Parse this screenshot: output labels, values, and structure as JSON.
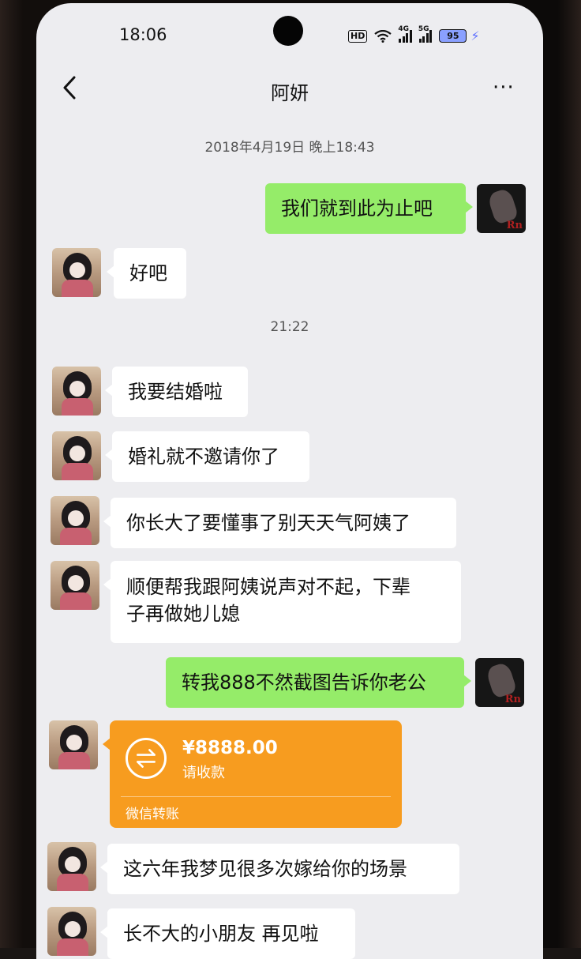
{
  "status_bar": {
    "time": "18:06",
    "hd": "HD",
    "signal1": "4G",
    "signal2": "5G",
    "battery": "95"
  },
  "header": {
    "title": "阿妍",
    "more": "···"
  },
  "timestamps": {
    "first": "2018年4月19日 晚上18:43",
    "second": "21:22"
  },
  "messages": {
    "m1": "我们就到此为止吧",
    "m2": "好吧",
    "m3": "我要结婚啦",
    "m4": "婚礼就不邀请你了",
    "m5": "你长大了要懂事了别天天气阿姨了",
    "m6_line1": "顺便帮我跟阿姨说声对不起，下辈",
    "m6_line2": "子再做她儿媳",
    "m7": "转我888不然截图告诉你老公",
    "m9": "这六年我梦见很多次嫁给你的场景",
    "m10": "长不大的小朋友 再见啦"
  },
  "transfer": {
    "amount": "¥8888.00",
    "status": "请收款",
    "footer": "微信转账"
  },
  "avatars": {
    "dark_mark": "Rn"
  },
  "colors": {
    "outgoing_bubble": "#95ec69",
    "incoming_bubble": "#ffffff",
    "transfer": "#f79c1f",
    "background": "#ededf0"
  }
}
